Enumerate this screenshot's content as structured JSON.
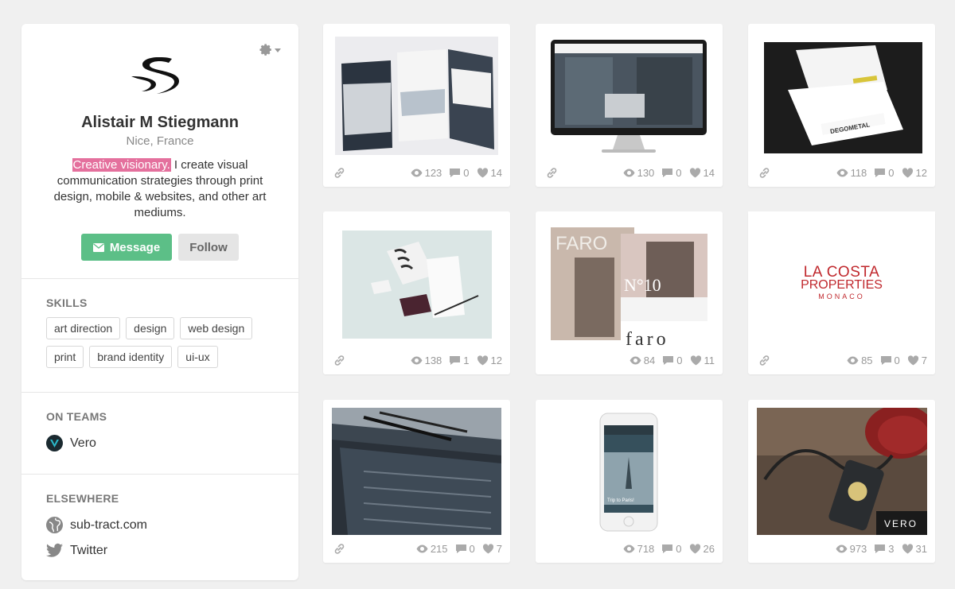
{
  "profile": {
    "name": "Alistair M Stiegmann",
    "location": "Nice, France",
    "bio_highlight": "Creative visionary.",
    "bio_rest": " I create visual communication strategies through print design, mobile & websites, and other art mediums.",
    "message_label": "Message",
    "follow_label": "Follow"
  },
  "skills": {
    "title": "SKILLS",
    "items": [
      "art direction",
      "design",
      "web design",
      "print",
      "brand identity",
      "ui-ux"
    ]
  },
  "teams": {
    "title": "ON TEAMS",
    "items": [
      {
        "name": "Vero",
        "icon": "vero-logo-icon"
      }
    ]
  },
  "elsewhere": {
    "title": "ELSEWHERE",
    "items": [
      {
        "label": "sub-tract.com",
        "icon": "globe-icon"
      },
      {
        "label": "Twitter",
        "icon": "twitter-icon"
      }
    ]
  },
  "projects": [
    {
      "views": "123",
      "comments": "0",
      "likes": "14"
    },
    {
      "views": "130",
      "comments": "0",
      "likes": "14"
    },
    {
      "views": "118",
      "comments": "0",
      "likes": "12"
    },
    {
      "views": "138",
      "comments": "1",
      "likes": "12"
    },
    {
      "views": "84",
      "comments": "0",
      "likes": "11"
    },
    {
      "views": "85",
      "comments": "0",
      "likes": "7"
    },
    {
      "views": "215",
      "comments": "0",
      "likes": "7"
    },
    {
      "views": "718",
      "comments": "0",
      "likes": "26"
    },
    {
      "views": "973",
      "comments": "3",
      "likes": "31"
    }
  ],
  "thumb_text": {
    "la_costa_1": "LA COSTA",
    "la_costa_2": "PROPERTIES",
    "la_costa_3": "MONACO",
    "faro_big": "FARO",
    "faro_no": "N°10",
    "faro_small": "faro",
    "vero_brand": "VERO",
    "degometal": "DEGOMETAL",
    "trip": "Trip to Paris!"
  },
  "colors": {
    "accent_green": "#5cbf87",
    "highlight_pink": "#e4709d",
    "la_costa_red": "#c0282d"
  }
}
